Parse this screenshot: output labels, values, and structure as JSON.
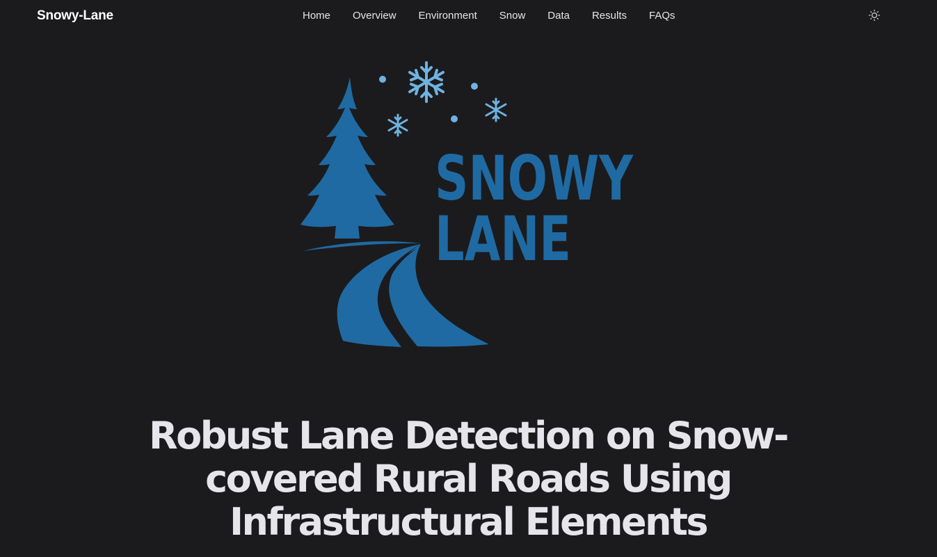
{
  "navbar": {
    "brand": "Snowy-Lane",
    "links": [
      "Home",
      "Overview",
      "Environment",
      "Snow",
      "Data",
      "Results",
      "FAQs"
    ],
    "theme_toggle_icon": "sun-icon"
  },
  "logo": {
    "line1": "SNOWY",
    "line2": "LANE",
    "color_primary": "#1f6aa3",
    "color_snow": "#6fb2e0"
  },
  "hero": {
    "title": "Robust Lane Detection on Snow-covered Rural Roads Using Infrastructural Elements"
  }
}
